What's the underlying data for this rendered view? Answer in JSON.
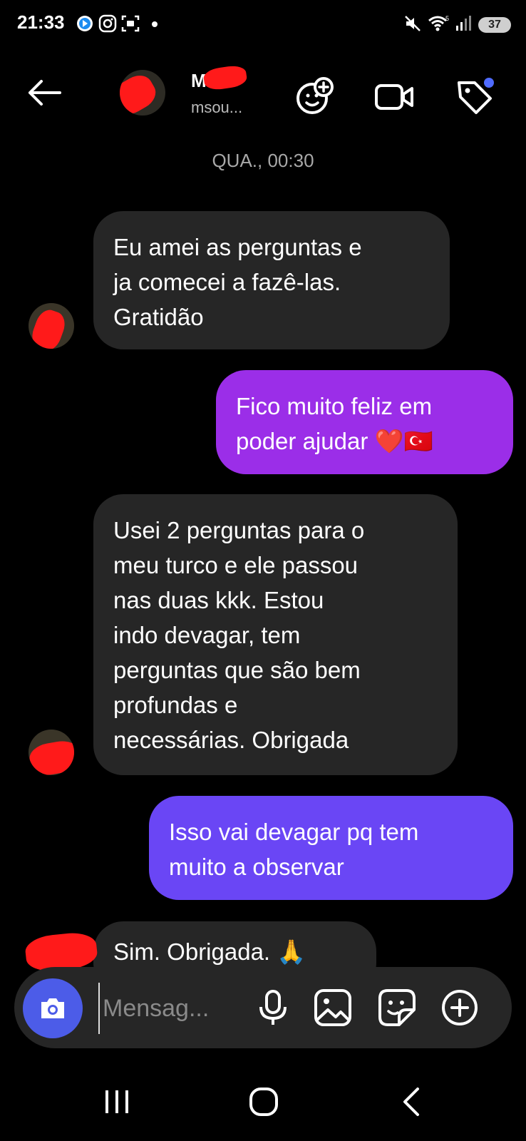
{
  "status_bar": {
    "time": "21:33",
    "battery": "37",
    "icons": [
      "signal-app-icon",
      "instagram-icon",
      "screenshot-icon",
      "dot-icon",
      "mute-icon",
      "wifi-icon",
      "signal-bars-icon"
    ]
  },
  "header": {
    "name": "M...",
    "handle": "msou...",
    "icons": [
      "back-arrow-icon",
      "add-emoji-icon",
      "video-call-icon",
      "tag-icon"
    ],
    "accent": "#4f6bff"
  },
  "conversation": {
    "date_divider": "QUA., 00:30",
    "messages": [
      {
        "direction": "in",
        "text": "Eu amei as perguntas e\nja comecei a fazê-las.\nGratidão"
      },
      {
        "direction": "out",
        "text": "Fico muito feliz em\npoder ajudar ❤️🇹🇷"
      },
      {
        "direction": "in",
        "text": "Usei 2 perguntas para o\nmeu turco e ele passou\nnas duas kkk. Estou\nindo devagar, tem\nperguntas que são bem\nprofundas e\nnecessárias.  Obrigada"
      },
      {
        "direction": "out",
        "text": "Isso vai devagar pq tem\nmuito a observar"
      },
      {
        "direction": "in",
        "text": "Sim. Obrigada. 🙏"
      }
    ],
    "colors": {
      "incoming": "#262626",
      "outgoing_1": "#9b2ee8",
      "outgoing_2": "#6a46f5"
    }
  },
  "composer": {
    "placeholder": "Mensag...",
    "icons": [
      "camera-icon",
      "microphone-icon",
      "gallery-icon",
      "sticker-icon",
      "plus-circle-icon"
    ]
  },
  "nav_bar": {
    "icons": [
      "recent-apps-icon",
      "home-icon",
      "back-icon"
    ]
  }
}
